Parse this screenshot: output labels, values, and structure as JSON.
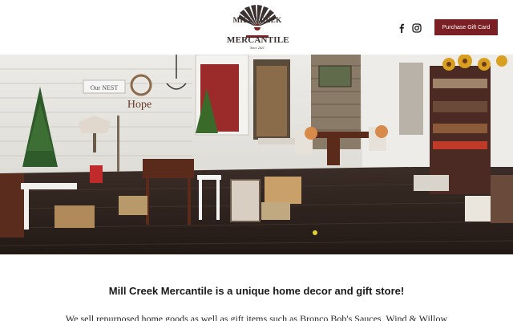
{
  "brand": {
    "line1": "MILL CREEK",
    "line2": "MERCANTILE",
    "established": "Since 2021",
    "colors": {
      "ink": "#3a3130",
      "accent": "#7a1f24"
    }
  },
  "header": {
    "social": [
      {
        "name": "facebook",
        "icon": "facebook-icon"
      },
      {
        "name": "instagram",
        "icon": "instagram-icon"
      }
    ],
    "cta_label": "Purchase Gift Card"
  },
  "hero": {
    "sign_left": "Our NEST",
    "sign_hope": "Hope"
  },
  "main": {
    "tagline": "Mill Creek Mercantile is a unique home decor and gift store!",
    "intro": "We sell repurposed home goods as well as gift items such as Bronco Bob's Sauces, Wind & Willow"
  }
}
